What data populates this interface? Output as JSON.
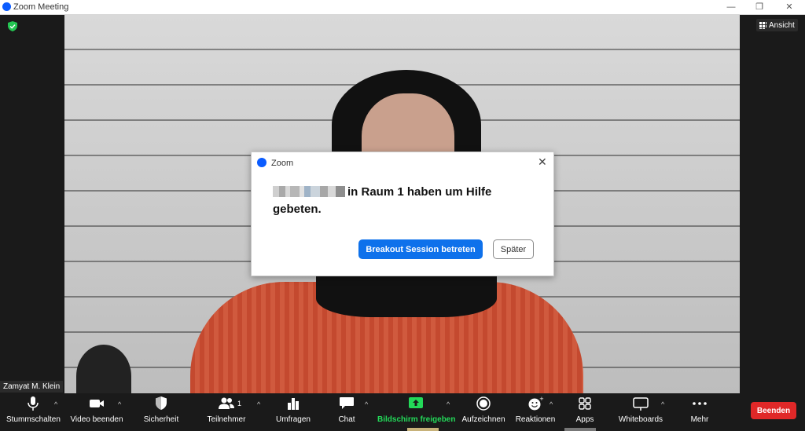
{
  "window": {
    "title": "Zoom Meeting"
  },
  "view_button": {
    "label": "Ansicht"
  },
  "participant": {
    "name": "Zamyat M. Klein"
  },
  "dialog": {
    "title": "Zoom",
    "message_line1": "in Raum 1 haben um Hilfe",
    "message_line2": "gebeten.",
    "primary_label": "Breakout Session betreten",
    "secondary_label": "Später"
  },
  "toolbar": {
    "mute": "Stummschalten",
    "video": "Video beenden",
    "security": "Sicherheit",
    "participants": "Teilnehmer",
    "participants_count": "1",
    "polls": "Umfragen",
    "chat": "Chat",
    "share": "Bildschirm freigeben",
    "record": "Aufzeichnen",
    "reactions": "Reaktionen",
    "apps": "Apps",
    "whiteboards": "Whiteboards",
    "more": "Mehr",
    "end": "Beenden"
  },
  "colors": {
    "accent": "#0e71eb",
    "end": "#e02828",
    "share": "#23d959"
  }
}
